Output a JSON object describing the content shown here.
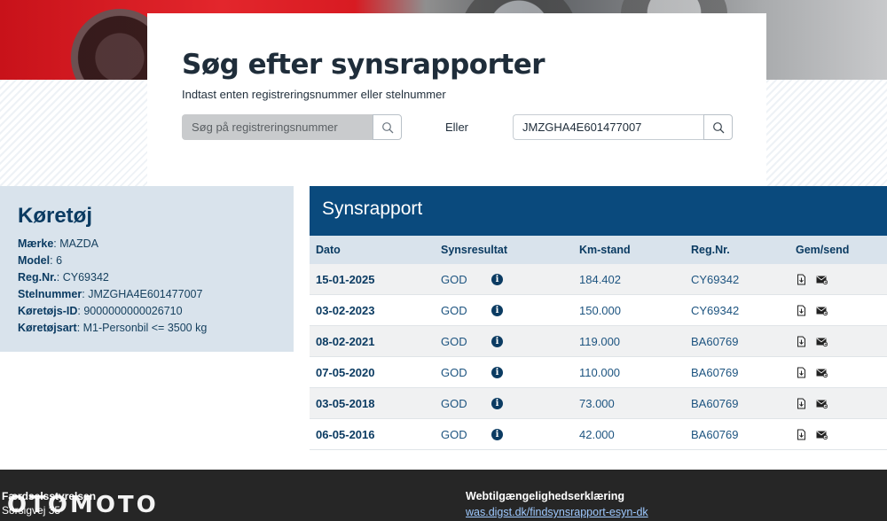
{
  "search": {
    "title": "Søg efter synsrapporter",
    "subtitle": "Indtast enten registreringsnummer eller stelnummer",
    "reg_placeholder": "Søg på registreringsnummer",
    "or_label": "Eller",
    "vin_value": "JMZGHA4E601477007"
  },
  "vehicle": {
    "title": "Køretøj",
    "rows": [
      {
        "label": "Mærke",
        "value": "MAZDA"
      },
      {
        "label": "Model",
        "value": "6"
      },
      {
        "label": "Reg.Nr.",
        "value": "CY69342"
      },
      {
        "label": "Stelnummer",
        "value": "JMZGHA4E601477007"
      },
      {
        "label": "Køretøjs-ID",
        "value": "9000000000026710"
      },
      {
        "label": "Køretøjsart",
        "value": "M1-Personbil <= 3500 kg"
      }
    ]
  },
  "report": {
    "title": "Synsrapport",
    "columns": [
      "Dato",
      "Synsresultat",
      "Km-stand",
      "Reg.Nr.",
      "Gem/send"
    ],
    "rows": [
      {
        "date": "15-01-2025",
        "result": "GOD",
        "km": "184.402",
        "reg": "CY69342"
      },
      {
        "date": "03-02-2023",
        "result": "GOD",
        "km": "150.000",
        "reg": "CY69342"
      },
      {
        "date": "08-02-2021",
        "result": "GOD",
        "km": "119.000",
        "reg": "BA60769"
      },
      {
        "date": "07-05-2020",
        "result": "GOD",
        "km": "110.000",
        "reg": "BA60769"
      },
      {
        "date": "03-05-2018",
        "result": "GOD",
        "km": "73.000",
        "reg": "BA60769"
      },
      {
        "date": "06-05-2016",
        "result": "GOD",
        "km": "42.000",
        "reg": "BA60769"
      }
    ],
    "info_glyph": "i"
  },
  "footer": {
    "org": "Færdselsstyrelsen",
    "address": "Sorsigvej 35",
    "access_title": "Webtilgængelighedserklæring",
    "access_link": "was.digst.dk/findsynsrapport-esyn-dk"
  },
  "watermark": "OTOMOTO",
  "colors": {
    "primary": "#0a4a7d",
    "panel": "#d9e3ec",
    "footer": "#262626"
  }
}
